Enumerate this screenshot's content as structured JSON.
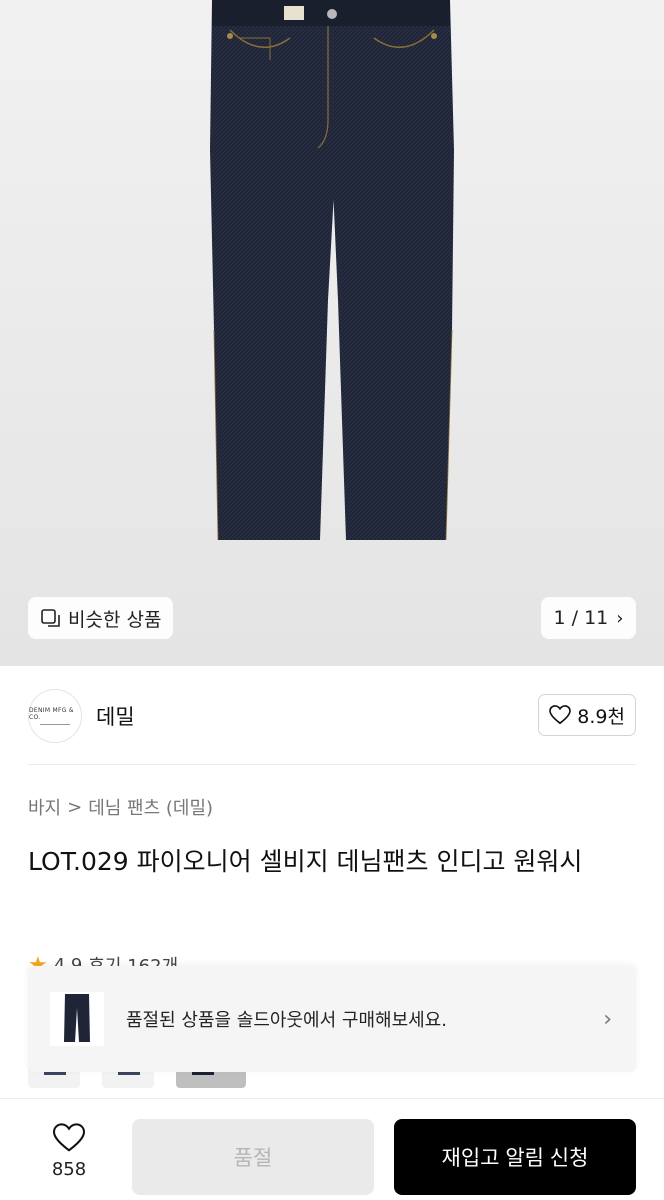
{
  "hero": {
    "similar_label": "비슷한 상품",
    "counter": "1 / 11"
  },
  "brand": {
    "logo_text": "DENIM MFG & CO.",
    "name": "데밀",
    "like_count": "8.9천"
  },
  "breadcrumb": {
    "first": "바지",
    "separator": ">",
    "second": "데님 팬츠 (데밀)"
  },
  "product": {
    "title": "LOT.029 파이오니어 셀비지 데님팬츠 인디고 원워시",
    "rating": "4.9",
    "reviews": "후기 162개"
  },
  "soldout_banner": {
    "text": "품절된 상품을 솔드아웃에서 구매해보세요."
  },
  "bottom_bar": {
    "wish_count": "858",
    "soldout_label": "품절",
    "restock_label": "재입고 알림 신청"
  },
  "colors": {
    "denim": "#1f2536",
    "accent_star": "#f5a623",
    "button_dark": "#000000",
    "button_disabled": "#eaeaea"
  }
}
